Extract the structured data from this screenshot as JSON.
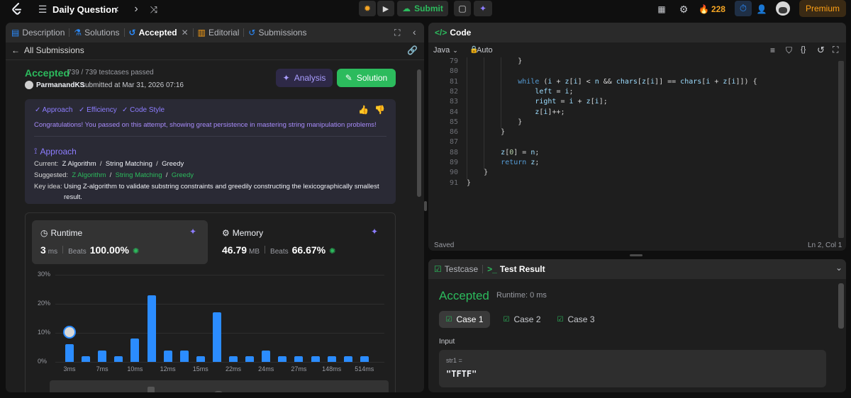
{
  "topbar": {
    "logo": "leetcode-logo",
    "title": "Daily Question",
    "submit_label": "Submit",
    "streak_count": "228",
    "premium_label": "Premium"
  },
  "left_panel": {
    "tabs": [
      {
        "label": "Description"
      },
      {
        "label": "Solutions"
      },
      {
        "label": "Accepted"
      },
      {
        "label": "Editorial"
      },
      {
        "label": "Submissions"
      }
    ],
    "back_label": "All Submissions",
    "status": "Accepted",
    "testcases": "739 / 739 testcases passed",
    "user": "ParmanandKS",
    "submitted_text": "submitted at Mar 31, 2026 07:16",
    "analysis_label": "Analysis",
    "solution_label": "Solution",
    "feedback": {
      "checks": [
        "Approach",
        "Efficiency",
        "Code Style"
      ],
      "message": "Congratulations! You passed on this attempt, showing great persistence in mastering string manipulation problems!",
      "approach_title": "Approach",
      "current_label": "Current:",
      "current": [
        "Z Algorithm",
        "String Matching",
        "Greedy"
      ],
      "suggested_label": "Suggested:",
      "suggested": [
        "Z Algorithm",
        "String Matching",
        "Greedy"
      ],
      "key_idea_label": "Key idea:",
      "key_idea_1": "Using Z-algorithm to validate substring constraints and greedily constructing the lexicographically smallest",
      "key_idea_2": "result."
    },
    "runtime": {
      "label": "Runtime",
      "value": "3",
      "unit": "ms",
      "beats_label": "Beats",
      "beats": "100.00%"
    },
    "memory": {
      "label": "Memory",
      "value": "46.79",
      "unit": "MB",
      "beats_label": "Beats",
      "beats": "66.67%"
    }
  },
  "chart_data": {
    "type": "bar",
    "yticks": [
      "30%",
      "20%",
      "10%",
      "0%"
    ],
    "ylim": [
      0,
      30
    ],
    "xtick_labels": [
      "3ms",
      "7ms",
      "10ms",
      "12ms",
      "15ms",
      "22ms",
      "24ms",
      "27ms",
      "148ms",
      "514ms"
    ],
    "values": [
      6,
      2,
      4,
      2,
      8,
      23,
      4,
      4,
      2,
      17,
      2,
      2,
      4,
      2,
      2,
      2,
      2,
      2,
      2
    ]
  },
  "code_panel": {
    "title": "Code",
    "language": "Java",
    "mode": "Auto",
    "lines": [
      {
        "n": "79",
        "text": "            }"
      },
      {
        "n": "80",
        "text": ""
      },
      {
        "n": "81",
        "text": "            while (i + z[i] < n && chars[z[i]] == chars[i + z[i]]) {"
      },
      {
        "n": "82",
        "text": "                left = i;"
      },
      {
        "n": "83",
        "text": "                right = i + z[i];"
      },
      {
        "n": "84",
        "text": "                z[i]++;"
      },
      {
        "n": "85",
        "text": "            }"
      },
      {
        "n": "86",
        "text": "        }"
      },
      {
        "n": "87",
        "text": ""
      },
      {
        "n": "88",
        "text": "        z[0] = n;"
      },
      {
        "n": "89",
        "text": "        return z;"
      },
      {
        "n": "90",
        "text": "    }"
      },
      {
        "n": "91",
        "text": "}"
      }
    ],
    "saved": "Saved",
    "cursor": "Ln 2, Col 1"
  },
  "test_panel": {
    "tab_testcase": "Testcase",
    "tab_result": "Test Result",
    "status": "Accepted",
    "runtime": "Runtime: 0 ms",
    "cases": [
      "Case 1",
      "Case 2",
      "Case 3"
    ],
    "input_label": "Input",
    "var_label": "str1 =",
    "var_value": "\"TFTF\""
  }
}
